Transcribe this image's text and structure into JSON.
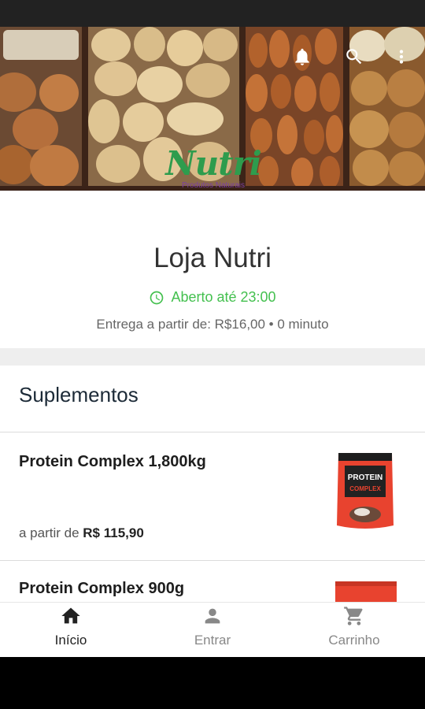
{
  "hero": {
    "logo_text": "Nutri",
    "logo_subtitle": "Produtos Naturais"
  },
  "toolbar": {
    "icons": [
      "bell-icon",
      "search-icon",
      "more-vert-icon"
    ]
  },
  "store": {
    "name": "Loja Nutri",
    "open_status": "Aberto até 23:00",
    "delivery_info": "Entrega a partir de: R$16,00 • 0 minuto"
  },
  "category": {
    "title": "Suplementos",
    "products": [
      {
        "name": "Protein Complex 1,800kg",
        "price_prefix": "a partir de",
        "price": "R$ 115,90",
        "image_label": "PROTEIN COMPLEX"
      },
      {
        "name": "Protein Complex 900g"
      }
    ]
  },
  "bottom_nav": {
    "items": [
      {
        "label": "Início",
        "icon": "home-icon",
        "active": true
      },
      {
        "label": "Entrar",
        "icon": "person-icon",
        "active": false
      },
      {
        "label": "Carrinho",
        "icon": "cart-icon",
        "active": false
      }
    ]
  },
  "colors": {
    "open_green": "#44c04f",
    "logo_green": "#2e9c4d",
    "logo_purple": "#7b3fa0",
    "nav_active": "#222222",
    "nav_inactive": "#888888"
  }
}
